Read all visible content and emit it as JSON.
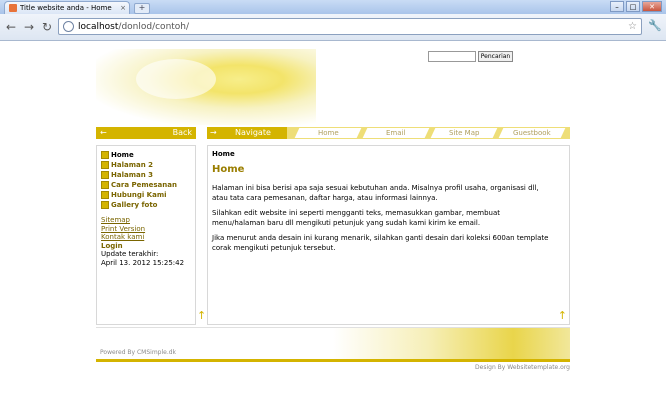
{
  "browser": {
    "tab_title": "Title website anda - Home",
    "tab_close": "×",
    "new_tab": "+",
    "window_min": "–",
    "window_max": "□",
    "window_close": "✕",
    "url_host": "localhost",
    "url_path": "/donlod/contoh/",
    "back": "←",
    "forward": "→",
    "reload": "↻",
    "star": "☆",
    "wrench": "🔧"
  },
  "search": {
    "value": "",
    "button": "Pencarian"
  },
  "back_bar": {
    "arrow": "←",
    "label": "Back"
  },
  "navbar": {
    "arrow": "→",
    "label": "Navigate",
    "links": [
      "Home",
      "Email",
      "Site Map",
      "Guestbook"
    ]
  },
  "menu": [
    {
      "label": "Home",
      "active": true
    },
    {
      "label": "Halaman 2"
    },
    {
      "label": "Halaman 3"
    },
    {
      "label": "Cara Pemesanan"
    },
    {
      "label": "Hubungi Kami"
    },
    {
      "label": "Gallery foto"
    }
  ],
  "sidebar_links": {
    "sitemap": "Sitemap",
    "print": "Print Version",
    "contact": "Kontak kami",
    "login": "Login",
    "updated_label": "Update terakhir:",
    "updated_date": "April 13. 2012 15:25:42"
  },
  "content": {
    "breadcrumb": "Home",
    "heading": "Home",
    "p1": "Halaman ini bisa berisi apa saja sesuai kebutuhan anda. Misalnya profil usaha, organisasi dll, atau tata cara pemesanan, daftar harga, atau informasi lainnya.",
    "p2": "Silahkan edit website ini seperti mengganti teks, memasukkan gambar, membuat menu/halaman baru dll mengikuti petunjuk yang sudah kami kirim ke email.",
    "p3": "Jika menurut anda desain ini kurang menarik, silahkan ganti desain dari koleksi 600an template corak mengikuti petunjuk tersebut."
  },
  "footer": {
    "powered": "Powered By CMSimple.dk",
    "design": "Design By Websitetemplate.org"
  },
  "up_arrow": "↑"
}
